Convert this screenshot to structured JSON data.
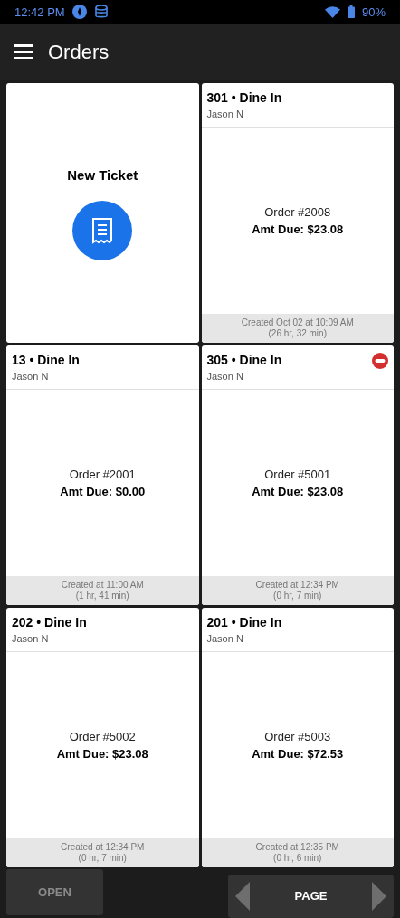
{
  "status_bar": {
    "time": "12:42 PM",
    "battery": "90%"
  },
  "app_bar": {
    "title": "Orders"
  },
  "tickets": [
    {
      "kind": "new",
      "label": "New Ticket"
    },
    {
      "kind": "order",
      "title": "301 • Dine In",
      "server": "Jason N",
      "order": "Order #2008",
      "amount": "Amt Due: $23.08",
      "created": "Created Oct 02 at 10:09 AM",
      "elapsed": "(26 hr, 32 min)",
      "alert": false
    },
    {
      "kind": "order",
      "title": "13 • Dine In",
      "server": "Jason N",
      "order": "Order #2001",
      "amount": "Amt Due: $0.00",
      "created": "Created at 11:00 AM",
      "elapsed": "(1 hr, 41 min)",
      "alert": false
    },
    {
      "kind": "order",
      "title": "305 • Dine In",
      "server": "Jason N",
      "order": "Order #5001",
      "amount": "Amt Due: $23.08",
      "created": "Created at 12:34 PM",
      "elapsed": "(0 hr, 7 min)",
      "alert": true
    },
    {
      "kind": "order",
      "title": "202 • Dine In",
      "server": "Jason N",
      "order": "Order #5002",
      "amount": "Amt Due: $23.08",
      "created": "Created at 12:34 PM",
      "elapsed": "(0 hr, 7 min)",
      "alert": false
    },
    {
      "kind": "order",
      "title": "201 • Dine In",
      "server": "Jason N",
      "order": "Order #5003",
      "amount": "Amt Due: $72.53",
      "created": "Created at 12:35 PM",
      "elapsed": "(0 hr, 6 min)",
      "alert": false
    }
  ],
  "bottom_bar": {
    "open_button": {
      "label": "OPEN",
      "disabled": true
    },
    "pager": {
      "label": "PAGE"
    }
  }
}
